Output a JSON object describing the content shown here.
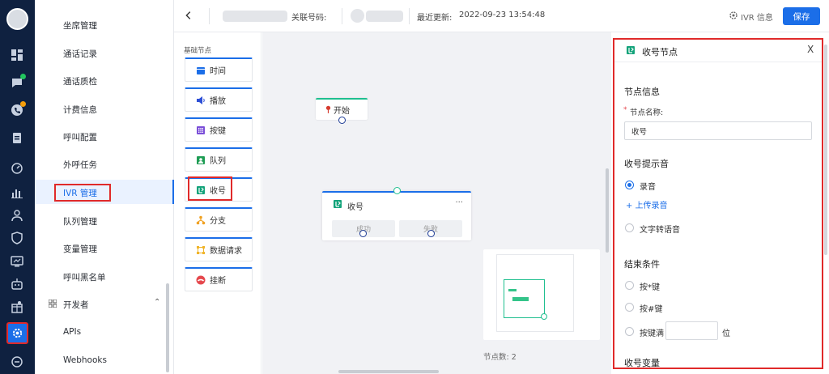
{
  "menu": {
    "items": [
      {
        "label": "坐席管理"
      },
      {
        "label": "通话记录"
      },
      {
        "label": "通话质检"
      },
      {
        "label": "计费信息"
      },
      {
        "label": "呼叫配置"
      },
      {
        "label": "外呼任务"
      },
      {
        "label": "IVR 管理",
        "active": true
      },
      {
        "label": "队列管理"
      },
      {
        "label": "变量管理"
      },
      {
        "label": "呼叫黑名单"
      }
    ],
    "group_label": "开发者",
    "sub_items": [
      {
        "label": "APIs"
      },
      {
        "label": "Webhooks"
      }
    ]
  },
  "header": {
    "related_number_label": "关联号码:",
    "last_update_label": "最近更新:",
    "last_update_value": "2022-09-23 13:54:48",
    "ivr_info_label": "IVR 信息",
    "save_label": "保存"
  },
  "palette": {
    "title": "基础节点",
    "nodes": [
      {
        "label": "时间",
        "icon": "calendar-icon",
        "color": "#1b6ee8"
      },
      {
        "label": "播放",
        "icon": "speaker-icon",
        "color": "#2d4fd6"
      },
      {
        "label": "按键",
        "icon": "keypad-icon",
        "color": "#7b4fd8"
      },
      {
        "label": "队列",
        "icon": "queue-icon",
        "color": "#1f9d55"
      },
      {
        "label": "收号",
        "icon": "collect-digits-icon",
        "color": "#13a37a"
      },
      {
        "label": "分支",
        "icon": "branch-icon",
        "color": "#f0a020"
      },
      {
        "label": "数据请求",
        "icon": "data-request-icon",
        "color": "#f0b429"
      },
      {
        "label": "挂断",
        "icon": "hangup-icon",
        "color": "#e5484d"
      }
    ]
  },
  "canvas": {
    "start_node": {
      "label": "开始"
    },
    "collect_node": {
      "title": "收号",
      "more": "···",
      "success_label": "成功",
      "fail_label": "失败"
    },
    "node_count_label": "节点数: 2"
  },
  "right_panel": {
    "title": "收号节点",
    "close": "X",
    "section_node_info": "节点信息",
    "required_mark": "*",
    "node_name_label": "节点名称:",
    "node_name_value": "收号",
    "section_prompt": "收号提示音",
    "prompt_options": [
      {
        "label": "录音",
        "selected": true
      },
      {
        "label": "文字转语音",
        "selected": false
      }
    ],
    "upload_label": "+ 上传录音",
    "section_end": "结束条件",
    "end_options": [
      {
        "label": "按*键"
      },
      {
        "label": "按#键"
      },
      {
        "label": "按键满"
      }
    ],
    "digits_unit": "位",
    "section_variable": "收号变量"
  }
}
